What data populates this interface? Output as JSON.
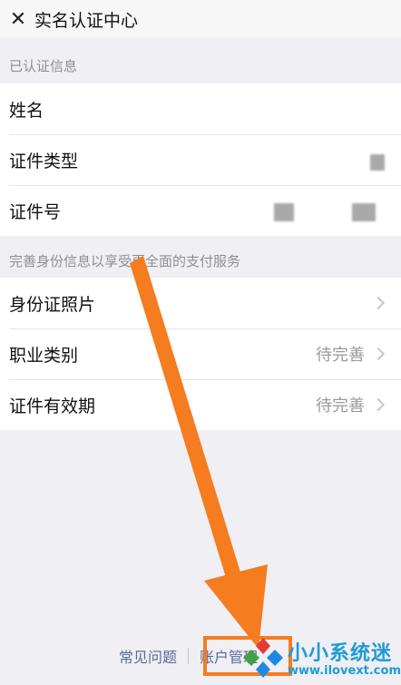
{
  "header": {
    "close_icon": "close-icon",
    "title": "实名认证中心"
  },
  "verified": {
    "section_label": "已认证信息",
    "rows": [
      {
        "label": "姓名"
      },
      {
        "label": "证件类型"
      },
      {
        "label": "证件号"
      }
    ]
  },
  "complete": {
    "section_label": "完善身份信息以享受更全面的支付服务",
    "rows": [
      {
        "label": "身份证照片",
        "value": ""
      },
      {
        "label": "职业类别",
        "value": "待完善"
      },
      {
        "label": "证件有效期",
        "value": "待完善"
      }
    ]
  },
  "footer": {
    "faq": "常见问题",
    "account": "账户管理"
  },
  "annotation": {
    "color": "#f57c1f"
  },
  "watermark": {
    "brand": "小小系统迷",
    "url": "www.ilovext.com"
  }
}
